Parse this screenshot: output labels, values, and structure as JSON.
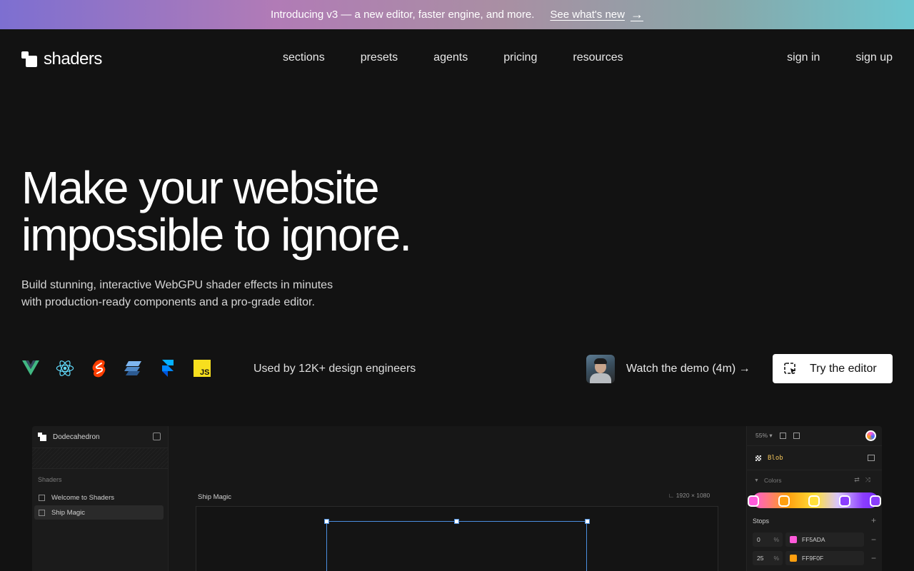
{
  "announcement": {
    "message": "Introducing v3 — a new editor, faster engine, and more.",
    "link": "See what's new",
    "arrow": "→"
  },
  "nav": {
    "brand": "shaders",
    "links": [
      "sections",
      "presets",
      "agents",
      "pricing",
      "resources"
    ],
    "sign_in": "sign in",
    "sign_up": "sign up"
  },
  "hero": {
    "title_line1": "Make your website",
    "title_line2": "impossible to ignore.",
    "subtitle_line1": "Build stunning, interactive WebGPU shader effects in minutes",
    "subtitle_line2": "with production-ready components and a pro-grade editor."
  },
  "frameworks": [
    "vue-icon",
    "react-icon",
    "svelte-icon",
    "solid-icon",
    "framer-icon",
    "javascript-icon"
  ],
  "social_proof": "Used by 12K+ design engineers",
  "demo_link": "Watch the demo (4m) →",
  "cta": {
    "label": "Try the editor"
  },
  "editor": {
    "project_name": "Dodecahedron",
    "section_label": "Shaders",
    "items": [
      "Welcome to Shaders",
      "Ship Magic"
    ],
    "canvas_label": "Ship Magic",
    "canvas_size": "1920 × 1080",
    "zoom": "55%",
    "layer_name": "Blob",
    "colors_label": "Colors",
    "stops_label": "Stops",
    "stops": [
      {
        "position": "0",
        "unit": "%",
        "hex": "FF5ADA",
        "color": "#FF5ADA"
      },
      {
        "position": "25",
        "unit": "%",
        "hex": "FF9F0F",
        "color": "#FF9F0F"
      }
    ],
    "gradient_knob_colors": [
      "#FF5ADA",
      "#FF9F0F",
      "#FFE03A",
      "#8B3DFF",
      "#8B3DFF"
    ]
  },
  "colors": {
    "background": "#121212",
    "selection": "#4A8FE0",
    "cta_bg": "#FFFFFF"
  }
}
